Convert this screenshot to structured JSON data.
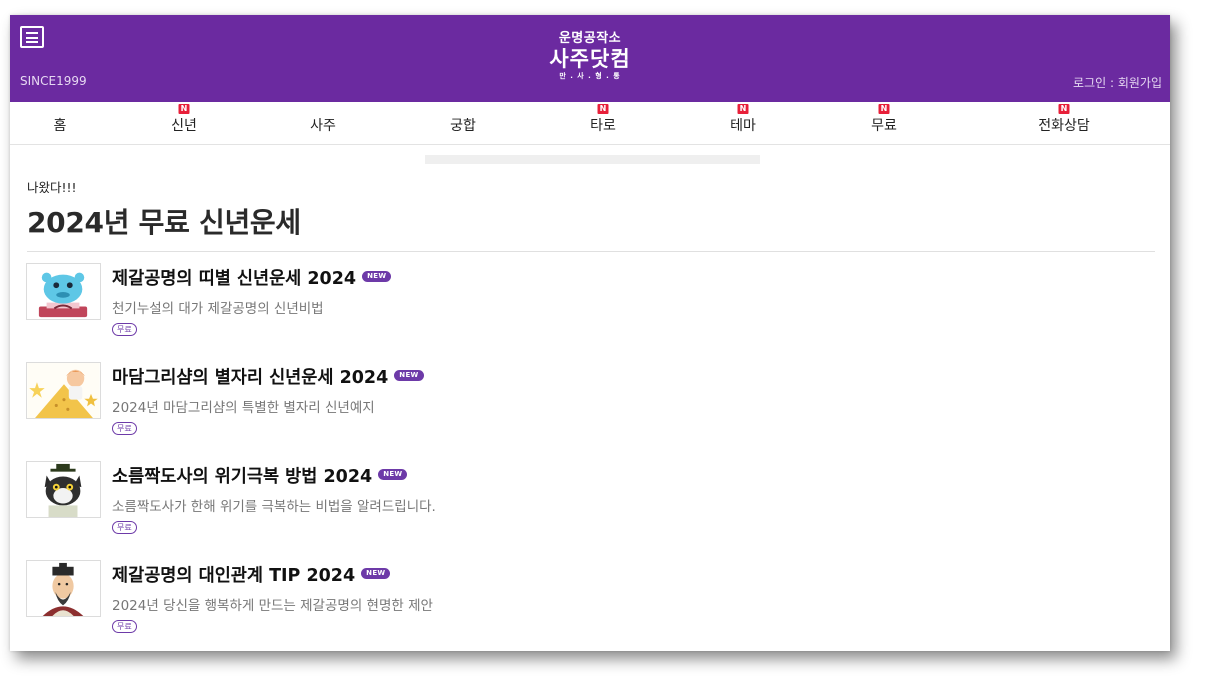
{
  "header": {
    "since": "SINCE1999",
    "logo_sub": "운명공작소",
    "logo_main": "사주닷컴",
    "logo_tag": "만 . 사 . 형 . 통",
    "login": "로그인",
    "separator": " : ",
    "signup": "회원가입",
    "colors": {
      "brand": "#6b2aa0",
      "badge": "#e8203a"
    }
  },
  "nav": {
    "items": [
      {
        "label": "홈",
        "badge": ""
      },
      {
        "label": "신년",
        "badge": "N"
      },
      {
        "label": "사주",
        "badge": ""
      },
      {
        "label": "궁합",
        "badge": ""
      },
      {
        "label": "타로",
        "badge": "N"
      },
      {
        "label": "테마",
        "badge": "N"
      },
      {
        "label": "무료",
        "badge": "N"
      },
      {
        "label": "전화상담",
        "badge": "N"
      }
    ]
  },
  "main": {
    "eyebrow": "나왔다!!!",
    "title": "2024년 무료 신년운세"
  },
  "list": {
    "items": [
      {
        "title": "제갈공명의 띠별 신년운세 2024",
        "badge": "NEW",
        "desc": "천기누설의 대가 제갈공명의 신년비법",
        "tag": "무료",
        "thumb_icon": "blue-dragon-character-icon"
      },
      {
        "title": "마담그리샴의 별자리 신년운세 2024",
        "badge": "NEW",
        "desc": "2024년 마담그리샴의 특별한 별자리 신년예지",
        "tag": "무료",
        "thumb_icon": "star-pyramid-girl-icon"
      },
      {
        "title": "소름짝도사의 위기극복 방법 2024",
        "badge": "NEW",
        "desc": "소름짝도사가 한해 위기를 극복하는 비법을 알려드립니다.",
        "tag": "무료",
        "thumb_icon": "black-cat-sage-icon"
      },
      {
        "title": "제갈공명의 대인관계 TIP 2024",
        "badge": "NEW",
        "desc": "2024년 당신을 행복하게 만드는 제갈공명의 현명한 제안",
        "tag": "무료",
        "thumb_icon": "zhuge-liang-portrait-icon"
      }
    ]
  }
}
